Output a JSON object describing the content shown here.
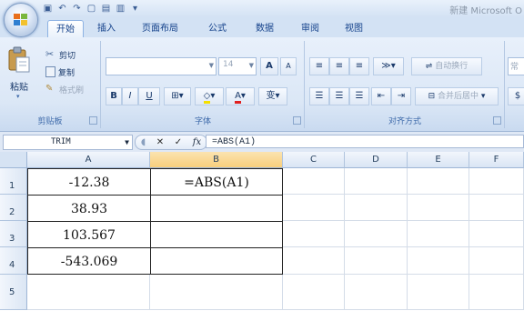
{
  "app": {
    "title": "新建 Microsoft O"
  },
  "ribbon_tabs": [
    "开始",
    "插入",
    "页面布局",
    "公式",
    "数据",
    "审阅",
    "视图"
  ],
  "clipboard": {
    "paste": "粘贴",
    "cut": "剪切",
    "copy": "复制",
    "format_painter": "格式刷",
    "label": "剪贴板"
  },
  "font": {
    "size": "14",
    "grow": "A",
    "shrink": "A",
    "bold": "B",
    "italic": "I",
    "underline": "U",
    "phonetic": "变",
    "label": "字体"
  },
  "alignment": {
    "wrap_text": "自动换行",
    "merge_center": "合并后居中",
    "label": "对齐方式"
  },
  "number": {
    "format_partial": "常"
  },
  "formula_bar": {
    "name_box": "TRIM",
    "fx": "fx",
    "formula": "=ABS(A1)"
  },
  "columns": [
    "A",
    "B",
    "C",
    "D",
    "E",
    "F"
  ],
  "rows": [
    "1",
    "2",
    "3",
    "4",
    "5"
  ],
  "cells": {
    "A1": "-12.38",
    "A2": "38.93",
    "A3": "103.567",
    "A4": "-543.069",
    "B1": "=ABS(A1)"
  },
  "colors": {
    "ribbon_bg": "#dbe7f6",
    "tab_text": "#15428b",
    "selected_header": "#f8cf7c"
  }
}
